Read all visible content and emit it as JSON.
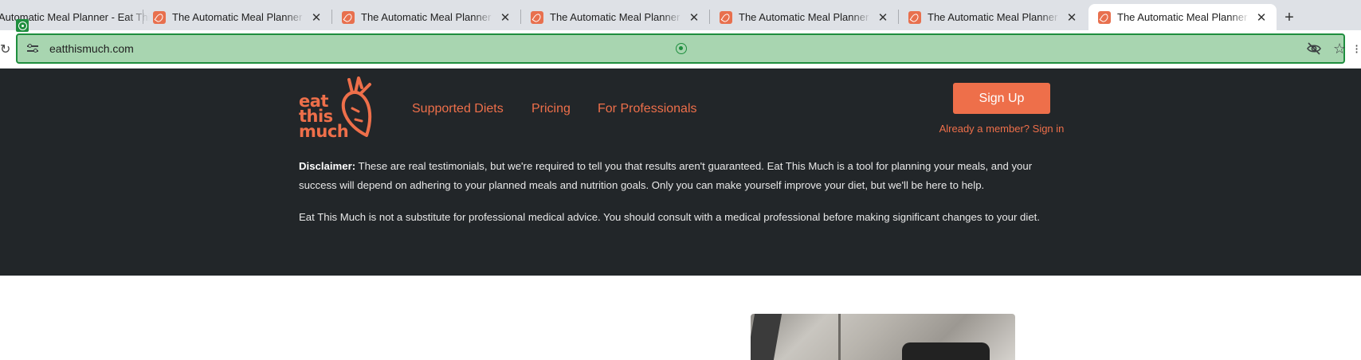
{
  "browser": {
    "tabs": [
      {
        "title": "The Automatic Meal Planner - Eat This Much"
      },
      {
        "title": "The Automatic Meal Planner - Eat This Much"
      },
      {
        "title": "The Automatic Meal Planner - Eat This Much"
      },
      {
        "title": "The Automatic Meal Planner - Eat This Much"
      },
      {
        "title": "The Automatic Meal Planner - Eat This Much"
      },
      {
        "title": "The Automatic Meal Planner - Eat This Much"
      },
      {
        "title": "The Automatic Meal Planner - Eat This Much"
      }
    ],
    "first_tab_visible_title": "Automatic Meal Planner - Eat This Much",
    "close_glyph": "✕",
    "new_tab_glyph": "+",
    "url": "eatthismuch.com",
    "star_glyph": "☆"
  },
  "site": {
    "logo": {
      "line1": "eat",
      "line2": "this",
      "line3": "much"
    },
    "nav": [
      {
        "label": "Supported Diets"
      },
      {
        "label": "Pricing"
      },
      {
        "label": "For Professionals"
      }
    ],
    "signup_label": "Sign Up",
    "signin_label": "Already a member? Sign in",
    "accent_color": "#ee6f4a",
    "header_color": "#222629"
  },
  "disclaimer": {
    "label": "Disclaimer:",
    "text": " These are real testimonials, but we're required to tell you that results aren't guaranteed. Eat This Much is a tool for planning your meals, and your success will depend on adhering to your planned meals and nutrition goals. Only you can make yourself improve your diet, but we'll be here to help.",
    "medical": "Eat This Much is not a substitute for professional medical advice. You should consult with a medical professional before making significant changes to your diet."
  }
}
